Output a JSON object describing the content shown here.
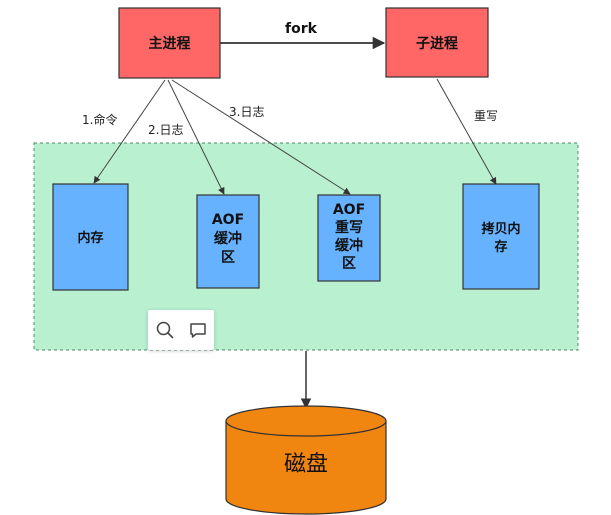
{
  "nodes": {
    "main_process": "主进程",
    "child_process": "子进程",
    "memory": "内存",
    "aof_buffer": [
      "AOF",
      "缓冲",
      "区"
    ],
    "aof_rewrite_buffer": [
      "AOF",
      "重写",
      "缓冲",
      "区"
    ],
    "copy_memory": [
      "拷贝内",
      "存"
    ],
    "disk": "磁盘"
  },
  "edges": {
    "fork": "fork",
    "command": "1.命令",
    "log2": "2.日志",
    "log3": "3.日志",
    "rewrite": "重写"
  },
  "colors": {
    "process_fill": "#ff6666",
    "block_fill": "#66b2ff",
    "container_fill": "#b8f0d0",
    "disk_fill": "#f0850f"
  },
  "toolbar": {
    "icons": [
      "search-icon",
      "comment-icon"
    ]
  }
}
